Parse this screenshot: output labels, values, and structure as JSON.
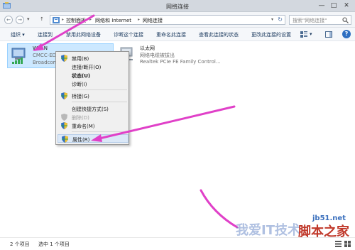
{
  "window": {
    "title": "网络连接",
    "minimize": "—",
    "maximize": "□",
    "close": "✕"
  },
  "nav": {
    "back": "←",
    "forward": "→",
    "recent": "▾",
    "up": "↑"
  },
  "breadcrumb": {
    "items": [
      "控制面板",
      "网络和 Internet",
      "网络连接"
    ],
    "separator": "▸",
    "dropdown": "▾",
    "refresh": "↻"
  },
  "search": {
    "placeholder": "搜索\"网络连接\""
  },
  "toolbar": {
    "organize": "组织 ▾",
    "connect_to": "连接到",
    "disable_device": "禁用此网络设备",
    "diagnose": "诊断这个连接",
    "rename": "重命名此连接",
    "view_status": "查看此连接的状态",
    "change_settings": "更改此连接的设置",
    "view_menu": "▾",
    "help": "?"
  },
  "connections": [
    {
      "name": "WLAN",
      "line1": "CMCC-EDU",
      "line2": "Broadcom"
    },
    {
      "name": "以太网",
      "line1": "网络电缆被拔出",
      "line2": "Realtek PCIe FE Family Control..."
    }
  ],
  "context_menu": {
    "items": [
      {
        "label": "禁用(B)"
      },
      {
        "label": "连接/断开(O)"
      },
      {
        "label": "状态(U)"
      },
      {
        "label": "诊断(I)"
      },
      {
        "label": "桥接(G)"
      },
      {
        "label": "创建快捷方式(S)"
      },
      {
        "label": "删除(D)"
      },
      {
        "label": "重命名(M)"
      },
      {
        "label": "属性(R)"
      }
    ]
  },
  "status": {
    "count": "2 个项目",
    "selected": "选中 1 个项目"
  },
  "watermark": {
    "site": "jb51.net",
    "name": "脚本之家",
    "mid": "我爱IT技术"
  },
  "colors": {
    "accent": "#2f6fc1",
    "selection": "#cce8ff",
    "arrow": "#e040c8"
  }
}
